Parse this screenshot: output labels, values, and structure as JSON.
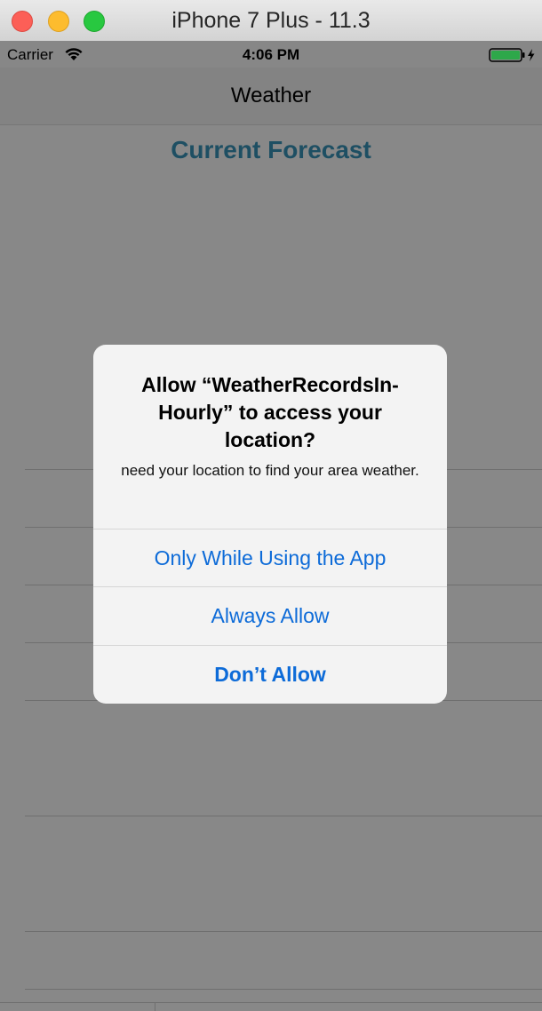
{
  "window": {
    "title": "iPhone 7 Plus - 11.3"
  },
  "statusbar": {
    "carrier": "Carrier",
    "time": "4:06 PM",
    "wifi_icon": "wifi-icon",
    "battery_icon": "battery-charging-icon"
  },
  "navbar": {
    "title": "Weather"
  },
  "content": {
    "heading": "Current Forecast"
  },
  "alert": {
    "title": "Allow “WeatherRecordsIn-Hourly” to access your location?",
    "message": "need your location to find your area weather.",
    "buttons": [
      {
        "label": "Only While Using the App"
      },
      {
        "label": "Always Allow"
      },
      {
        "label": "Don’t Allow"
      }
    ]
  },
  "colors": {
    "accent": "#0d6bd8",
    "heading": "#1e4f63",
    "dim_overlay": "#888888"
  }
}
